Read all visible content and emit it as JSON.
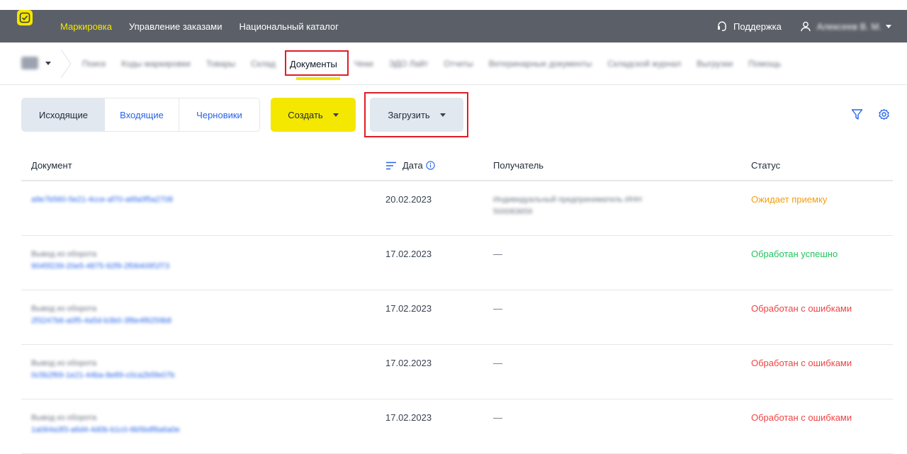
{
  "topbar": {
    "nav": [
      "Маркировка",
      "Управление заказами",
      "Национальный каталог"
    ],
    "support": "Поддержка",
    "user": "Алексеев В. М."
  },
  "subnav": {
    "tabs_before": [
      "Поиск",
      "Коды маркировки",
      "Товары",
      "Склад"
    ],
    "active_tab": "Документы",
    "tabs_after": [
      "Чеки",
      "ЭДО Лайт",
      "Отчеты",
      "Ветеринарные документы",
      "Складской журнал",
      "Выгрузки",
      "Помощь"
    ]
  },
  "toolbar": {
    "segments": [
      "Исходящие",
      "Входящие",
      "Черновики"
    ],
    "create": "Создать",
    "upload": "Загрузить"
  },
  "table": {
    "headers": {
      "document": "Документ",
      "date": "Дата",
      "recipient": "Получатель",
      "status": "Статус"
    },
    "rows": [
      {
        "doc_title": "",
        "doc_id": "a9e7b560-5e21-4cce-af70-a6fa0f5a2708",
        "date": "20.02.2023",
        "recipient": "Индивидуальный предприниматель ИНН 500083659",
        "status": "Ожидает приемку",
        "status_color": "#f59e0b"
      },
      {
        "doc_title": "Вывод из оборота",
        "doc_id": "9045f239-20e5-4875-92f9-2f06409f1f73",
        "date": "17.02.2023",
        "recipient": "—",
        "status": "Обработан успешно",
        "status_color": "#22c55e"
      },
      {
        "doc_title": "Вывод из оборота",
        "doc_id": "2f3247b6-a0f5-4a5d-b3b0-3f8e4f8259b8",
        "date": "17.02.2023",
        "recipient": "—",
        "status": "Обработан с ошибками",
        "status_color": "#ef4444"
      },
      {
        "doc_title": "Вывод из оборота",
        "doc_id": "0c5b2f69-1e21-44ba-8e89-c0ca2b5fe07b",
        "date": "17.02.2023",
        "recipient": "—",
        "status": "Обработан с ошибками",
        "status_color": "#ef4444"
      },
      {
        "doc_title": "Вывод из оборота",
        "doc_id": "1a064a3f3-a6d4-4d0b-b1c0-6b5bdf8a6a0e",
        "date": "17.02.2023",
        "recipient": "—",
        "status": "Обработан с ошибками",
        "status_color": "#ef4444"
      }
    ]
  },
  "icons": [
    "logo-icon",
    "support-icon",
    "user-icon",
    "filter-icon",
    "gear-icon",
    "sort-icon",
    "info-icon"
  ],
  "colors": {
    "accent": "#f4e700",
    "topbar": "#5b6068",
    "highlight": "#e11d25",
    "link": "#2563eb"
  }
}
